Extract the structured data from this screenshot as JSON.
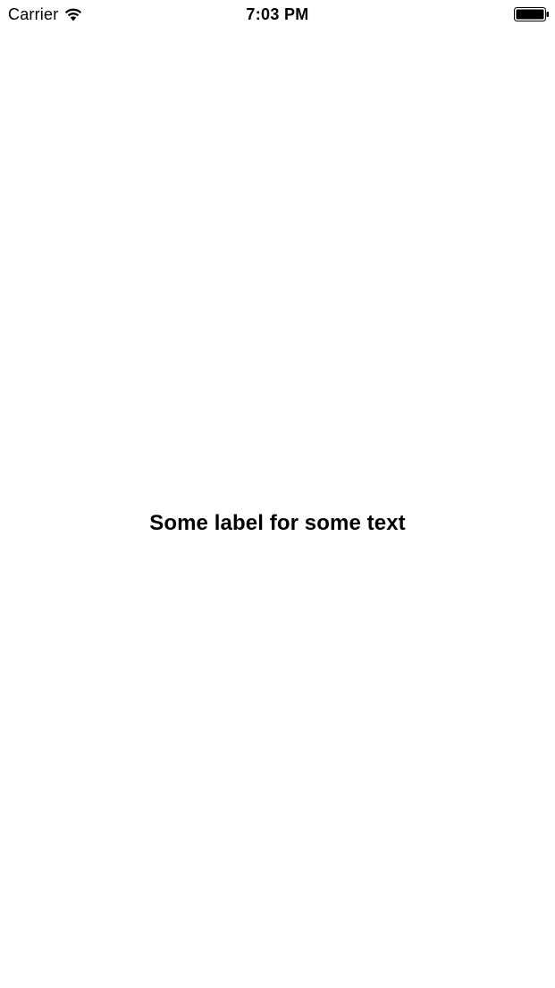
{
  "status_bar": {
    "carrier": "Carrier",
    "time": "7:03 PM",
    "wifi_icon": "wifi-icon",
    "battery_icon": "battery-full-icon"
  },
  "main": {
    "label_text": "Some label for some text"
  }
}
